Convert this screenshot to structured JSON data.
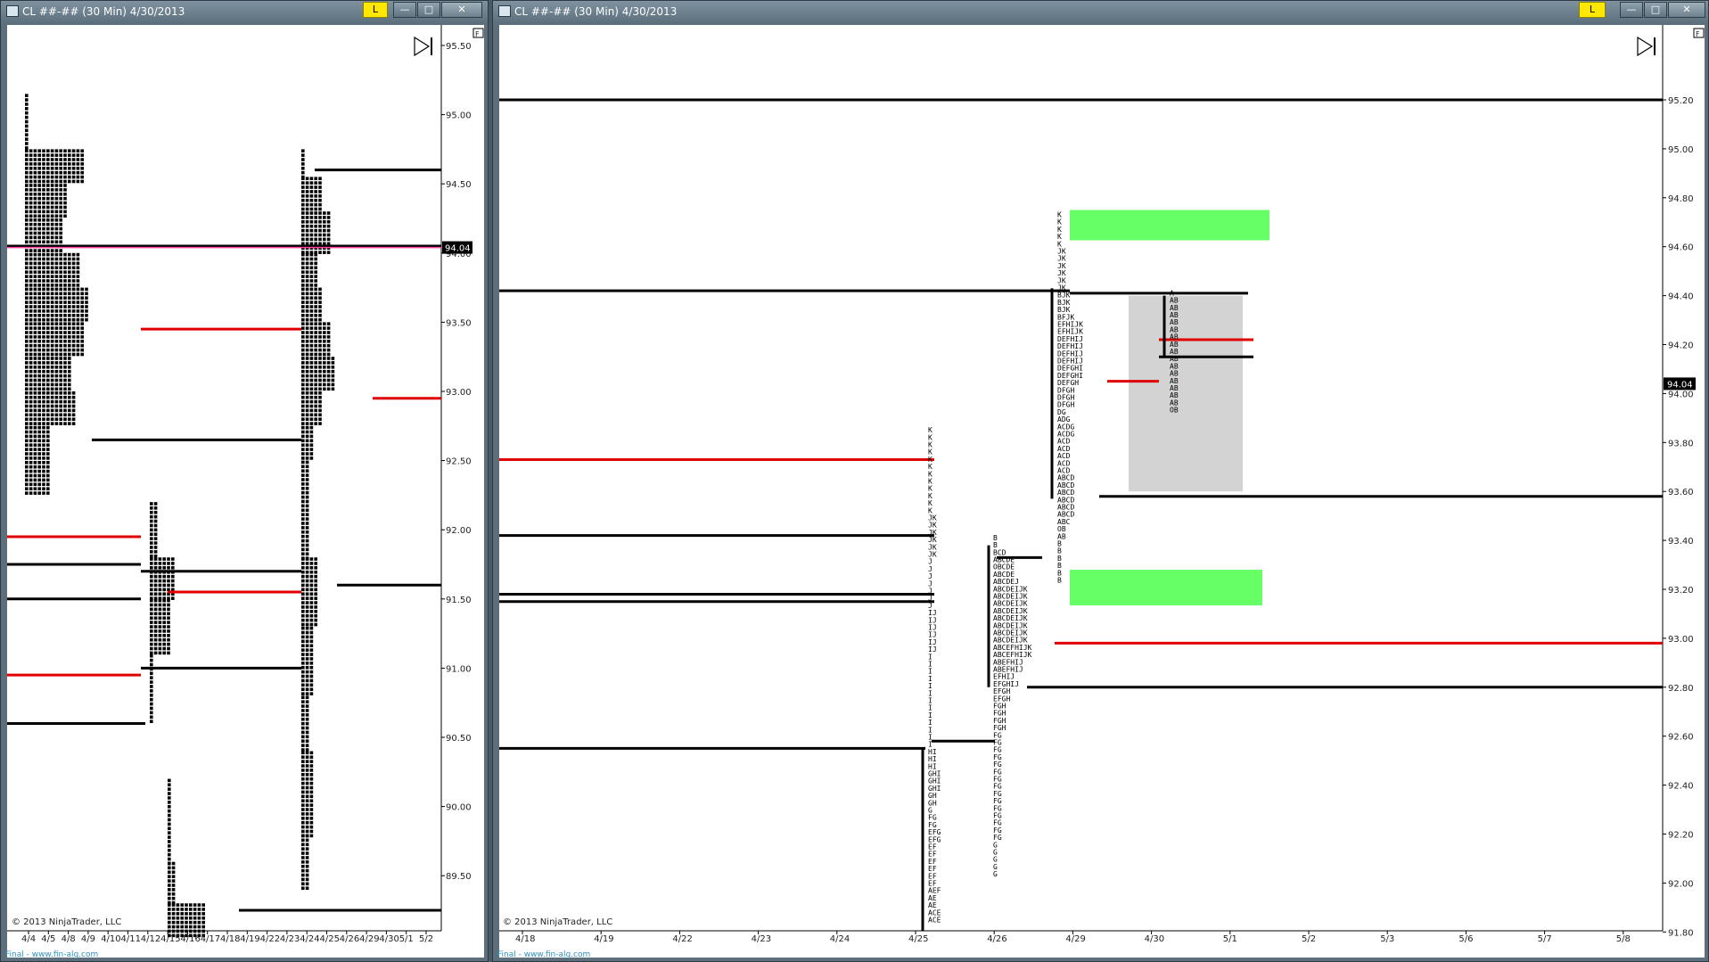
{
  "left_window": {
    "title": "CL ##-## (30 Min)  4/30/2013",
    "l_button": "L",
    "minimize_glyph": "—",
    "maximize_glyph": "□",
    "close_glyph": "✕",
    "f_button": "F",
    "copyright": "© 2013 NinjaTrader, LLC",
    "footer": "Final - www.fin-alg.com",
    "price_labels": [
      "95.50",
      "95.00",
      "94.50",
      "94.00",
      "93.50",
      "93.00",
      "92.50",
      "92.00",
      "91.50",
      "91.00",
      "90.50",
      "90.00",
      "89.50"
    ],
    "current_price": "94.04",
    "date_labels": [
      "4/4",
      "4/5",
      "4/8",
      "4/9",
      "4/10",
      "4/11",
      "4/12",
      "4/15",
      "4/16",
      "4/17",
      "4/18",
      "4/19",
      "4/22",
      "4/23",
      "4/24",
      "4/25",
      "4/26",
      "4/29",
      "4/30",
      "5/1",
      "5/2"
    ]
  },
  "right_window": {
    "title": "CL ##-## (30 Min)  4/30/2013",
    "l_button": "L",
    "minimize_glyph": "—",
    "maximize_glyph": "□",
    "close_glyph": "✕",
    "f_button": "F",
    "copyright": "© 2013 NinjaTrader, LLC",
    "footer": "Final - www.fin-alg.com",
    "price_labels": [
      "95.20",
      "95.00",
      "94.80",
      "94.60",
      "94.40",
      "94.20",
      "94.00",
      "93.80",
      "93.60",
      "93.40",
      "93.20",
      "93.00",
      "92.80",
      "92.60",
      "92.40",
      "92.20",
      "92.00",
      "91.80"
    ],
    "current_price": "94.04",
    "date_labels": [
      "4/18",
      "4/19",
      "4/22",
      "4/23",
      "4/24",
      "4/25",
      "4/26",
      "4/29",
      "4/30",
      "5/1",
      "5/2",
      "5/3",
      "5/6",
      "5/7",
      "5/8"
    ],
    "tpo_columns": [
      {
        "date": "4/25",
        "rows": [
          "K",
          "K",
          "K",
          "K",
          "K",
          "K",
          "K",
          "K",
          "K",
          "K",
          "K",
          "K",
          "JK",
          "JK",
          "JK",
          "JK",
          "JK",
          "JK",
          "J",
          "J",
          "J",
          "J",
          "J",
          "J",
          "J",
          "IJ",
          "IJ",
          "IJ",
          "IJ",
          "IJ",
          "IJ",
          "I",
          "I",
          "I",
          "I",
          "I",
          "I",
          "I",
          "I",
          "I",
          "I",
          "I",
          "I",
          "I",
          "HI",
          "HI",
          "HI",
          "GHI",
          "GHI",
          "GHI",
          "GH",
          "GH",
          "G",
          "FG",
          "FG",
          "EFG",
          "EFG",
          "EF",
          "EF",
          "EF",
          "EF",
          "EF",
          "EF",
          "AEF",
          "AE",
          "AE",
          "ACE",
          "ACE",
          "ACE"
        ]
      },
      {
        "date": "4/26",
        "rows": [
          "B",
          "B",
          "BCD",
          "ABCDE",
          "OBCDE",
          "ABCDE",
          "ABCDEJ",
          "ABCDEIJK",
          "ABCDEIJK",
          "ABCDEIJK",
          "ABCDEIJK",
          "ABCDEIJK",
          "ABCDEIJK",
          "ABCDEIJK",
          "ABCDEIJK",
          "ABCEFHIJK",
          "ABCEFHIJK",
          "ABEFHIJ",
          "ABEFHIJ",
          "EFHIJ",
          "EFGHIJ",
          "EFGH",
          "EFGH",
          "FGH",
          "FGH",
          "FGH",
          "FGH",
          "FG",
          "FG",
          "FG",
          "FG",
          "FG",
          "FG",
          "FG",
          "FG",
          "FG",
          "FG",
          "FG",
          "FG",
          "FG",
          "FG",
          "FG",
          "G",
          "G",
          "G",
          "G",
          "G"
        ]
      },
      {
        "date": "4/29",
        "rows": [
          "K",
          "K",
          "K",
          "K",
          "K",
          "JK",
          "JK",
          "JK",
          "JK",
          "JK",
          "JK",
          "BJK",
          "BJK",
          "BJK",
          "BFJK",
          "EFHIJK",
          "EFHIJK",
          "DEFHIJ",
          "DEFHIJ",
          "DEFHIJ",
          "DEFHIJ",
          "DEFGHI",
          "DEFGHI",
          "DEFGH",
          "DFGH",
          "DFGH",
          "DFGH",
          "DG",
          "ADG",
          "ACDG",
          "ACDG",
          "ACD",
          "ACD",
          "ACD",
          "ACD",
          "ACD",
          "ABCD",
          "ABCD",
          "ABCD",
          "ABCD",
          "ABCD",
          "ABCD",
          "ABC",
          "OB",
          "AB",
          "B",
          "B",
          "B",
          "B",
          "B",
          "B"
        ]
      },
      {
        "date": "4/30",
        "rows": [
          "A",
          "AB",
          "AB",
          "AB",
          "AB",
          "AB",
          "AB",
          "AB",
          "AB",
          "AB",
          "AB",
          "AB",
          "AB",
          "AB",
          "AB",
          "AB",
          "OB"
        ]
      }
    ]
  }
}
